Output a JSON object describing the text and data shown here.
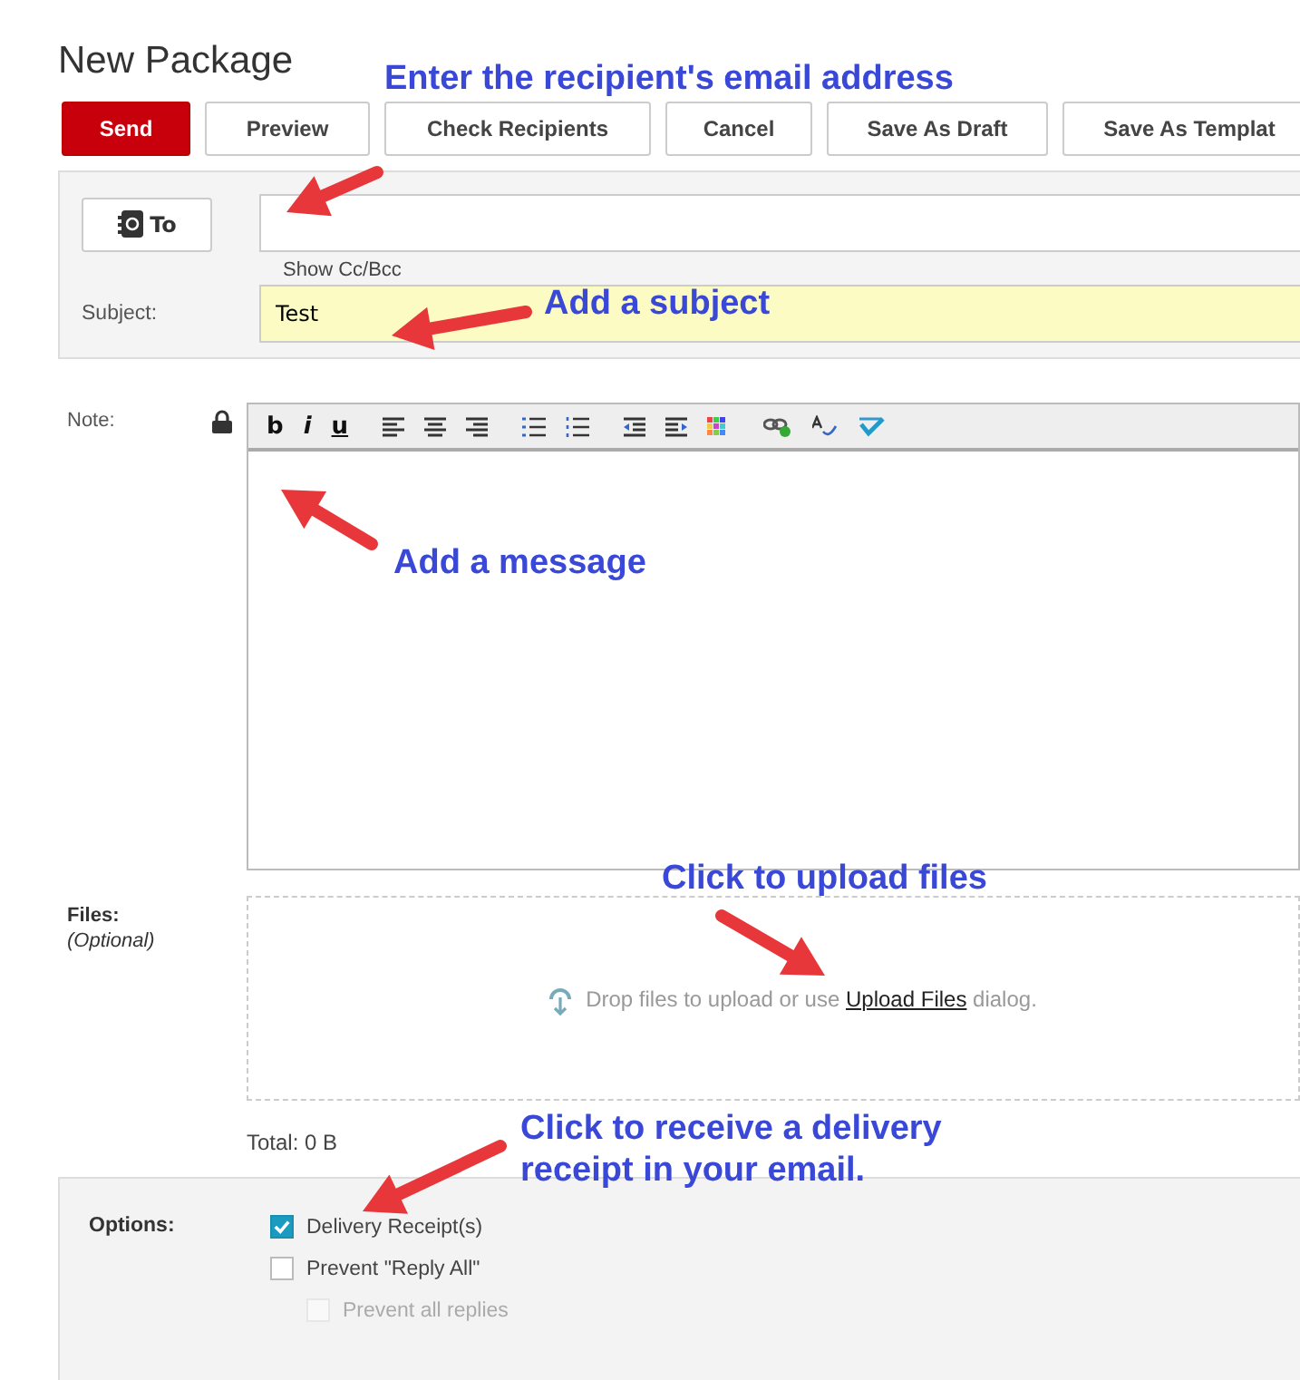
{
  "title": "New Package",
  "actions": [
    {
      "label": "Send",
      "kind": "primary"
    },
    {
      "label": "Preview",
      "kind": "default"
    },
    {
      "label": "Check Recipients",
      "kind": "default"
    },
    {
      "label": "Cancel",
      "kind": "default"
    },
    {
      "label": "Save As Draft",
      "kind": "default"
    },
    {
      "label": "Save As Templat",
      "kind": "default"
    }
  ],
  "recipients": {
    "button": "To",
    "cc_link": "Show Cc/Bcc"
  },
  "subject": {
    "label": "Subject:",
    "value": "Test"
  },
  "note": {
    "label": "Note:",
    "format_buttons": [
      "b",
      "i",
      "u"
    ]
  },
  "files": {
    "label": "Files:",
    "hint": "(Optional)",
    "drop_text": "Drop files to upload or use",
    "link": "Upload Files",
    "drop_suffix": "dialog.",
    "total": "Total: 0 B"
  },
  "options": {
    "label": "Options:",
    "items": [
      {
        "label": "Delivery Receipt(s)",
        "checked": true,
        "disabled": false
      },
      {
        "label": "Prevent \"Reply All\"",
        "checked": false,
        "disabled": false,
        "children": [
          {
            "label": "Prevent all replies",
            "checked": false,
            "disabled": true
          }
        ]
      }
    ]
  },
  "annotations": [
    {
      "text": "Enter the recipient's email address"
    },
    {
      "text": "Add a subject"
    },
    {
      "text": "Add a message"
    },
    {
      "text": "Click to upload files"
    },
    {
      "text": "Click to receive a delivery receipt in your email."
    }
  ]
}
